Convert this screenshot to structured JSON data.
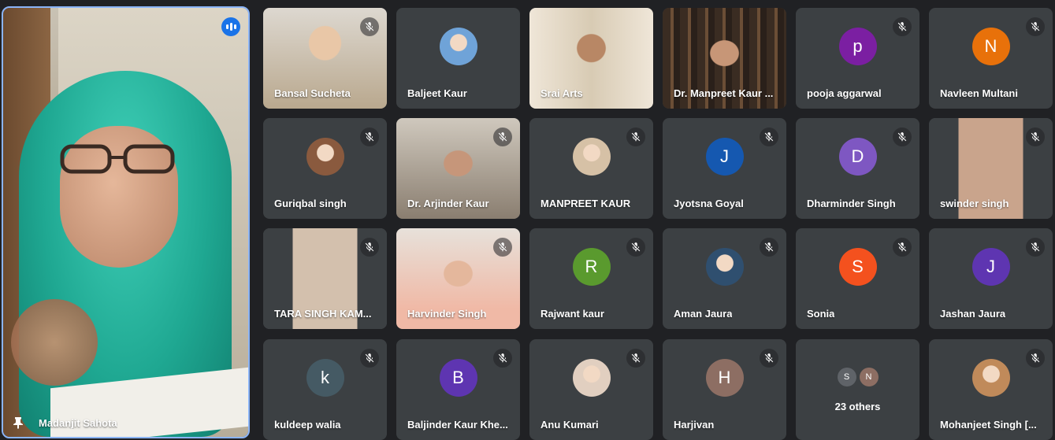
{
  "speaker": {
    "name": "Madanjit Sahota"
  },
  "icons": {
    "mic_off": "mic-off-icon",
    "speaking": "audio-bars-icon",
    "pin": "pin-icon"
  },
  "tiles": [
    {
      "name": "Bansal Sucheta"
    },
    {
      "name": "Baljeet Kaur"
    },
    {
      "name": "Srai Arts"
    },
    {
      "name": "Dr. Manpreet Kaur ..."
    },
    {
      "name": "pooja aggarwal",
      "initial": "p",
      "color": "#7b1fa2"
    },
    {
      "name": "Navleen Multani",
      "initial": "N",
      "color": "#e8710a"
    },
    {
      "name": "Guriqbal singh"
    },
    {
      "name": "Dr. Arjinder Kaur"
    },
    {
      "name": "MANPREET KAUR"
    },
    {
      "name": "Jyotsna Goyal",
      "initial": "J",
      "color": "#1558b0"
    },
    {
      "name": "Dharminder Singh",
      "initial": "D",
      "color": "#7e57c2"
    },
    {
      "name": "swinder singh"
    },
    {
      "name": "TARA SINGH KAM..."
    },
    {
      "name": "Harvinder Singh"
    },
    {
      "name": "Rajwant kaur",
      "initial": "R",
      "color": "#5a9a2e"
    },
    {
      "name": "Aman Jaura"
    },
    {
      "name": "Sonia",
      "initial": "S",
      "color": "#f4511e"
    },
    {
      "name": "Jashan Jaura",
      "initial": "J",
      "color": "#5e35b1"
    },
    {
      "name": "kuldeep walia",
      "initial": "k",
      "color": "#455a64"
    },
    {
      "name": "Baljinder Kaur Khe...",
      "initial": "B",
      "color": "#5e35b1"
    },
    {
      "name": "Anu Kumari"
    },
    {
      "name": "Harjivan",
      "initial": "H",
      "color": "#8d6e63"
    },
    {
      "name": "Mohanjeet Singh [..."
    }
  ],
  "others": {
    "label": "23 others",
    "initials": [
      "S",
      "N"
    ],
    "colors": [
      "#5f6368",
      "#8d6e63"
    ]
  }
}
